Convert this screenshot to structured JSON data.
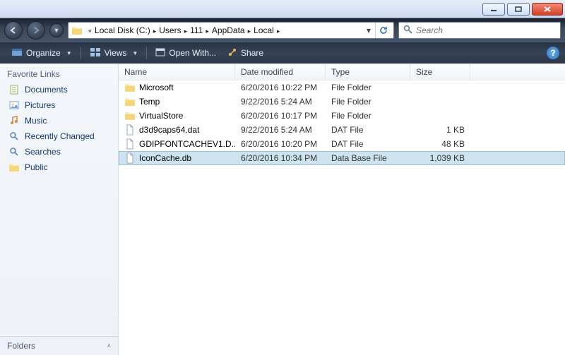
{
  "window": {
    "min_tip": "Minimize",
    "max_tip": "Maximize",
    "close_tip": "Close"
  },
  "address": {
    "segments": [
      "Local Disk (C:)",
      "Users",
      "111",
      "AppData",
      "Local"
    ],
    "ellipsis_prefix": "«"
  },
  "search": {
    "placeholder": "Search"
  },
  "toolbar": {
    "organize": "Organize",
    "views": "Views",
    "open_with": "Open With...",
    "share": "Share"
  },
  "sidebar": {
    "header": "Favorite Links",
    "items": [
      {
        "label": "Documents",
        "icon": "documents"
      },
      {
        "label": "Pictures",
        "icon": "pictures"
      },
      {
        "label": "Music",
        "icon": "music"
      },
      {
        "label": "Recently Changed",
        "icon": "search"
      },
      {
        "label": "Searches",
        "icon": "search"
      },
      {
        "label": "Public",
        "icon": "folder"
      }
    ],
    "footer": "Folders"
  },
  "columns": {
    "name": "Name",
    "date": "Date modified",
    "type": "Type",
    "size": "Size"
  },
  "files": [
    {
      "name": "Microsoft",
      "date": "6/20/2016 10:22 PM",
      "type": "File Folder",
      "size": "",
      "icon": "folder",
      "selected": false
    },
    {
      "name": "Temp",
      "date": "9/22/2016 5:24 AM",
      "type": "File Folder",
      "size": "",
      "icon": "folder",
      "selected": false
    },
    {
      "name": "VirtualStore",
      "date": "6/20/2016 10:17 PM",
      "type": "File Folder",
      "size": "",
      "icon": "folder",
      "selected": false
    },
    {
      "name": "d3d9caps64.dat",
      "date": "9/22/2016 5:24 AM",
      "type": "DAT File",
      "size": "1 KB",
      "icon": "file",
      "selected": false
    },
    {
      "name": "GDIPFONTCACHEV1.D...",
      "date": "6/20/2016 10:20 PM",
      "type": "DAT File",
      "size": "48 KB",
      "icon": "file",
      "selected": false
    },
    {
      "name": "IconCache.db",
      "date": "6/20/2016 10:34 PM",
      "type": "Data Base File",
      "size": "1,039 KB",
      "icon": "file",
      "selected": true
    }
  ]
}
